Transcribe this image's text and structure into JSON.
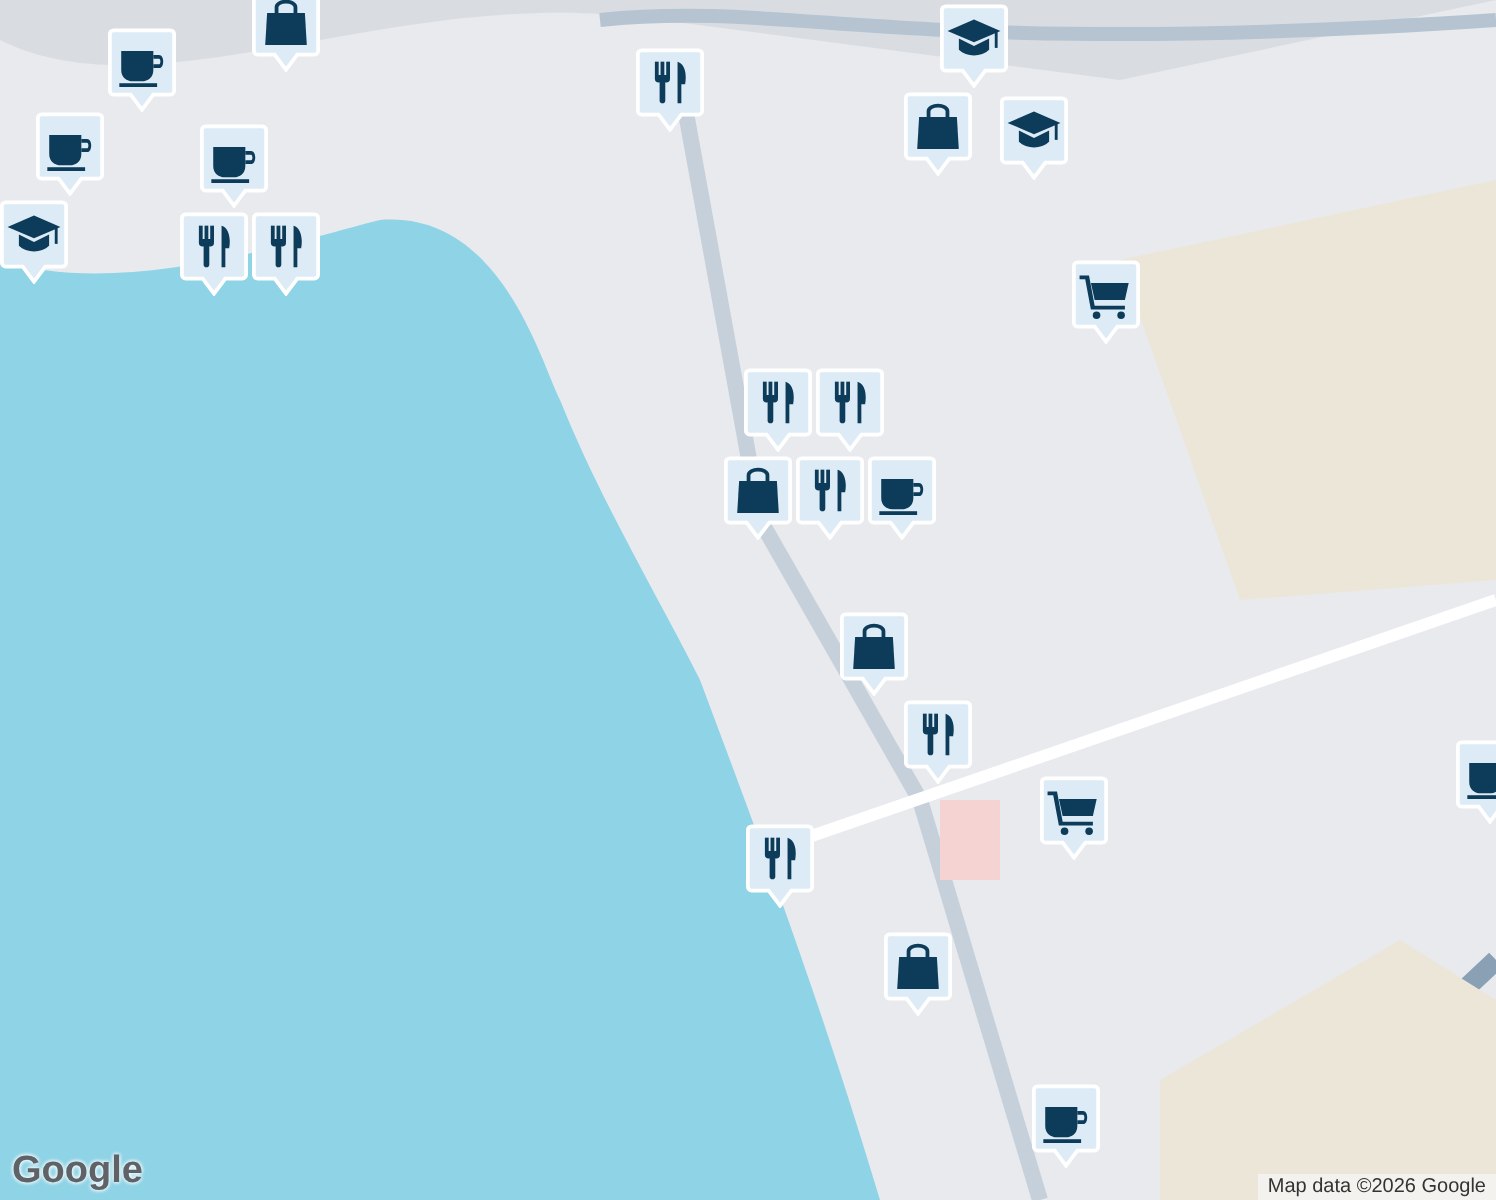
{
  "markers": [
    {
      "kind": "shopping"
    },
    {
      "kind": "cafe"
    },
    {
      "kind": "cafe"
    },
    {
      "kind": "school"
    },
    {
      "kind": "cafe"
    },
    {
      "kind": "restaurant"
    },
    {
      "kind": "restaurant"
    },
    {
      "kind": "restaurant"
    },
    {
      "kind": "school"
    },
    {
      "kind": "shopping"
    },
    {
      "kind": "school"
    },
    {
      "kind": "grocery"
    },
    {
      "kind": "restaurant"
    },
    {
      "kind": "restaurant"
    },
    {
      "kind": "shopping"
    },
    {
      "kind": "restaurant"
    },
    {
      "kind": "cafe"
    },
    {
      "kind": "shopping"
    },
    {
      "kind": "restaurant"
    },
    {
      "kind": "grocery"
    },
    {
      "kind": "restaurant"
    },
    {
      "kind": "shopping"
    },
    {
      "kind": "cafe"
    },
    {
      "kind": "cafe"
    }
  ],
  "logo": "Google",
  "attribution": "Map data ©2026 Google"
}
